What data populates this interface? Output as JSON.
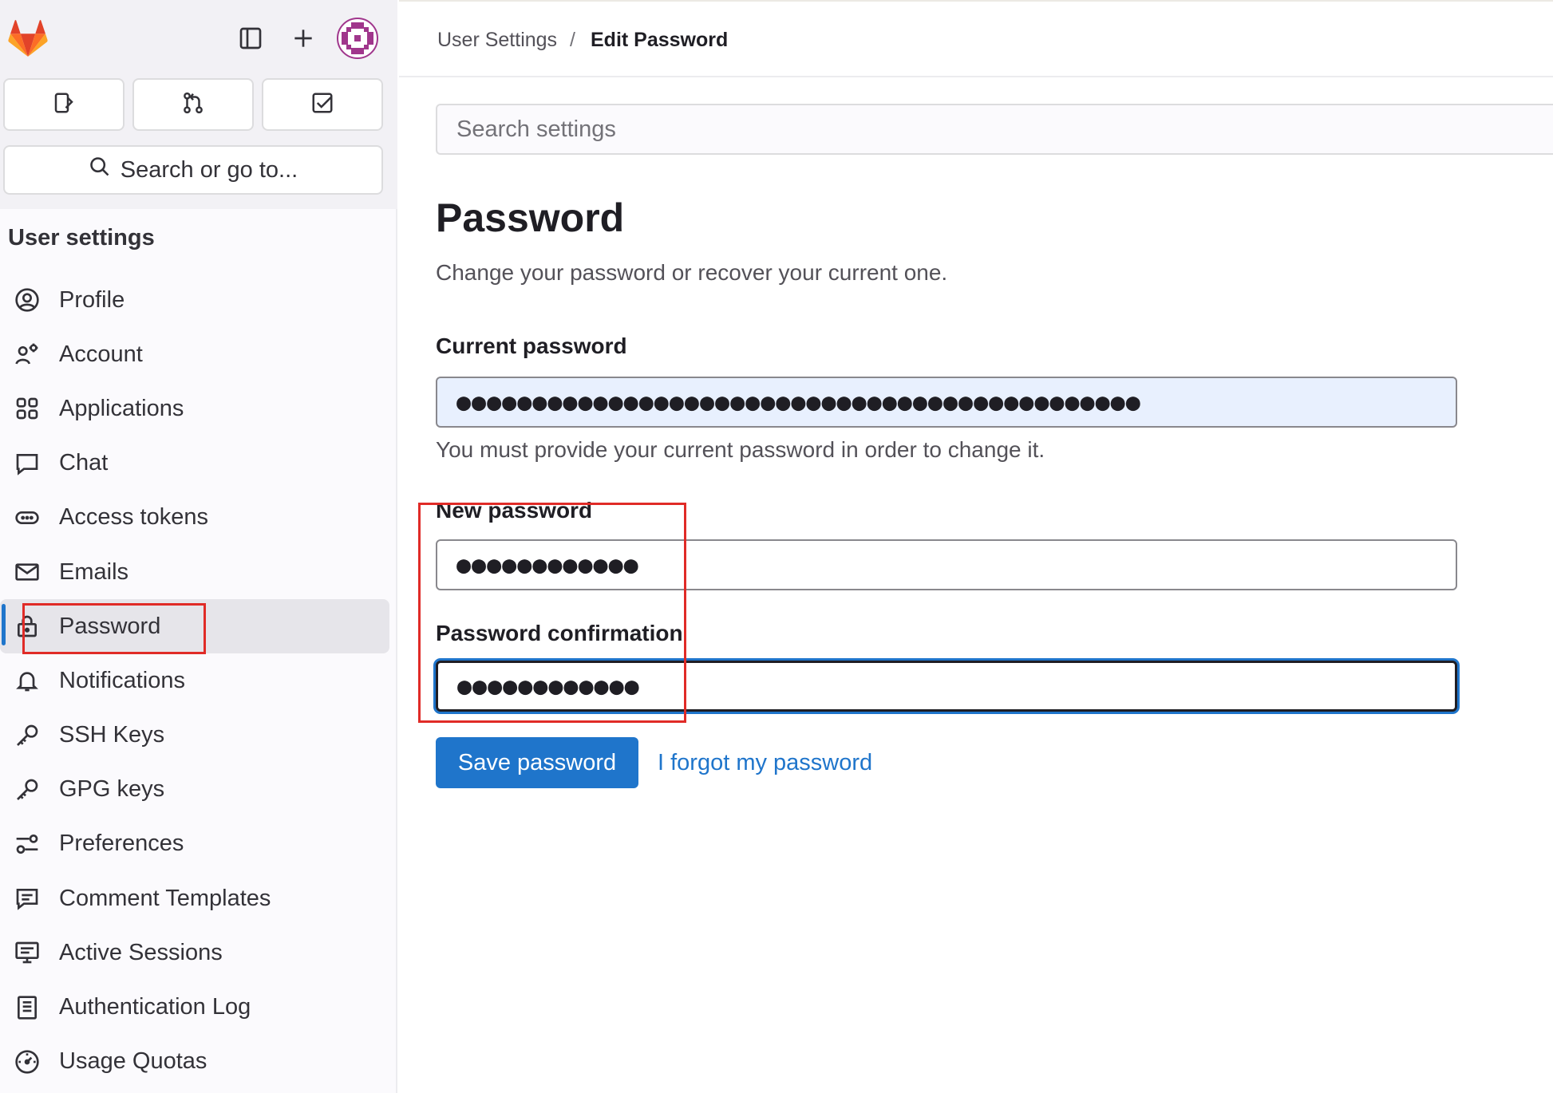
{
  "sidebar": {
    "quick_actions": [
      "issues-icon",
      "merge-request-icon",
      "todo-icon"
    ],
    "search_label": "Search or go to...",
    "title": "User settings",
    "items": [
      {
        "label": "Profile",
        "icon": "profile-icon"
      },
      {
        "label": "Account",
        "icon": "account-icon"
      },
      {
        "label": "Applications",
        "icon": "applications-icon"
      },
      {
        "label": "Chat",
        "icon": "chat-icon"
      },
      {
        "label": "Access tokens",
        "icon": "token-icon"
      },
      {
        "label": "Emails",
        "icon": "mail-icon"
      },
      {
        "label": "Password",
        "icon": "lock-icon",
        "active": true
      },
      {
        "label": "Notifications",
        "icon": "bell-icon"
      },
      {
        "label": "SSH Keys",
        "icon": "key-icon"
      },
      {
        "label": "GPG keys",
        "icon": "key-icon"
      },
      {
        "label": "Preferences",
        "icon": "preferences-icon"
      },
      {
        "label": "Comment Templates",
        "icon": "comment-icon"
      },
      {
        "label": "Active Sessions",
        "icon": "monitor-icon"
      },
      {
        "label": "Authentication Log",
        "icon": "log-icon"
      },
      {
        "label": "Usage Quotas",
        "icon": "quota-icon"
      }
    ]
  },
  "breadcrumb": {
    "parent": "User Settings",
    "separator": "/",
    "current": "Edit Password"
  },
  "search": {
    "placeholder": "Search settings"
  },
  "page": {
    "title": "Password",
    "description": "Change your password or recover your current one."
  },
  "form": {
    "current_label": "Current password",
    "current_value": "●●●●●●●●●●●●●●●●●●●●●●●●●●●●●●●●●●●●●●●●●●●●●",
    "current_help": "You must provide your current password in order to change it.",
    "new_label": "New password",
    "new_value": "●●●●●●●●●●●●",
    "confirm_label": "Password confirmation",
    "confirm_value": "●●●●●●●●●●●●",
    "save_label": "Save password",
    "forgot_label": "I forgot my password"
  },
  "colors": {
    "accent": "#1f75cb",
    "highlight": "#e02b27",
    "sidebar_bg": "#fbfafd"
  }
}
